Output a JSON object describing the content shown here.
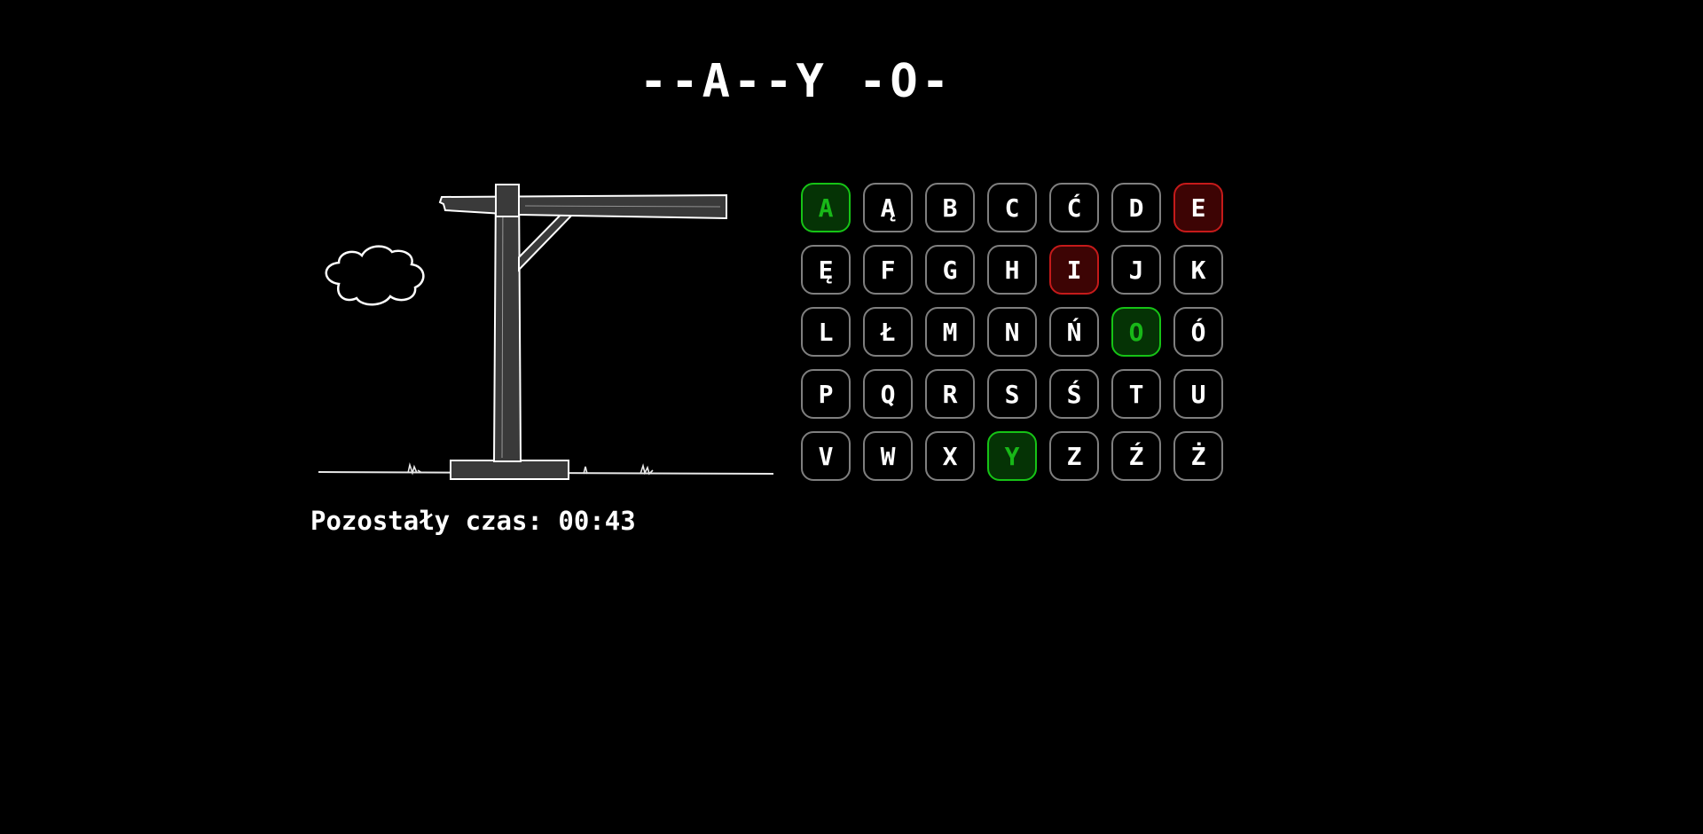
{
  "game": {
    "masked_word": "--A--Y -O-",
    "timer_label": "Pozostały czas:",
    "timer_value": "00:43",
    "wrong_guesses": 2
  },
  "colors": {
    "background": "#000000",
    "correct_border": "#16c316",
    "correct_text": "#18b818",
    "wrong_border": "#c51a1a",
    "wrong_fill": "#3d0404",
    "neutral_border": "#7f7f7f"
  },
  "keyboard": [
    {
      "letter": "A",
      "state": "correct"
    },
    {
      "letter": "Ą",
      "state": "unused"
    },
    {
      "letter": "B",
      "state": "unused"
    },
    {
      "letter": "C",
      "state": "unused"
    },
    {
      "letter": "Ć",
      "state": "unused"
    },
    {
      "letter": "D",
      "state": "unused"
    },
    {
      "letter": "E",
      "state": "wrong"
    },
    {
      "letter": "Ę",
      "state": "unused"
    },
    {
      "letter": "F",
      "state": "unused"
    },
    {
      "letter": "G",
      "state": "unused"
    },
    {
      "letter": "H",
      "state": "unused"
    },
    {
      "letter": "I",
      "state": "wrong"
    },
    {
      "letter": "J",
      "state": "unused"
    },
    {
      "letter": "K",
      "state": "unused"
    },
    {
      "letter": "L",
      "state": "unused"
    },
    {
      "letter": "Ł",
      "state": "unused"
    },
    {
      "letter": "M",
      "state": "unused"
    },
    {
      "letter": "N",
      "state": "unused"
    },
    {
      "letter": "Ń",
      "state": "unused"
    },
    {
      "letter": "O",
      "state": "correct"
    },
    {
      "letter": "Ó",
      "state": "unused"
    },
    {
      "letter": "P",
      "state": "unused"
    },
    {
      "letter": "Q",
      "state": "unused"
    },
    {
      "letter": "R",
      "state": "unused"
    },
    {
      "letter": "S",
      "state": "unused"
    },
    {
      "letter": "Ś",
      "state": "unused"
    },
    {
      "letter": "T",
      "state": "unused"
    },
    {
      "letter": "U",
      "state": "unused"
    },
    {
      "letter": "V",
      "state": "unused"
    },
    {
      "letter": "W",
      "state": "unused"
    },
    {
      "letter": "X",
      "state": "unused"
    },
    {
      "letter": "Y",
      "state": "correct"
    },
    {
      "letter": "Z",
      "state": "unused"
    },
    {
      "letter": "Ź",
      "state": "unused"
    },
    {
      "letter": "Ż",
      "state": "unused"
    }
  ]
}
